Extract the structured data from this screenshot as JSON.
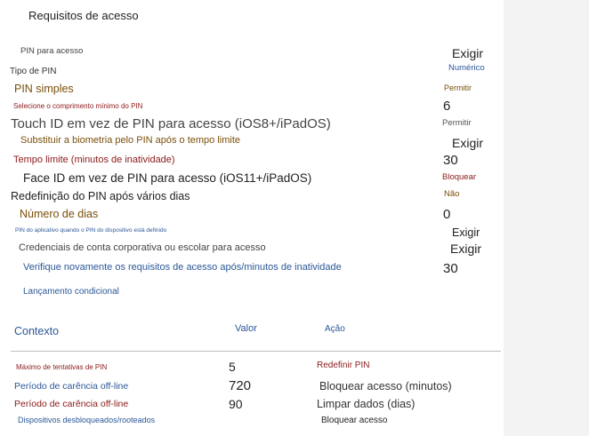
{
  "header": {
    "title": "Requisitos de acesso"
  },
  "settings": {
    "pin_acesso": {
      "label": "PIN para acesso",
      "value": "Exigir"
    },
    "tipo_pin": {
      "label": "Tipo de PIN",
      "value": "Numérico"
    },
    "pin_simples": {
      "label": "PIN simples",
      "value": "Permitir"
    },
    "comprimento_pin": {
      "label": "Selecione o comprimento mínimo do PIN",
      "value": "6"
    },
    "touch_id": {
      "label": "Touch ID em vez de PIN para acesso (iOS8+/iPadOS)",
      "value": "Permitir"
    },
    "biometria": {
      "label": "Substituir a biometria pelo PIN após o tempo limite",
      "value": "Exigir"
    },
    "tempo_limite": {
      "label": "Tempo limite (minutos de inatividade)",
      "value": "30"
    },
    "face_id": {
      "label": "Face ID em vez de PIN para acesso (iOS11+/iPadOS)",
      "value": "Bloquear"
    },
    "redefinicao_pin": {
      "label": "Redefinição do PIN após vários dias",
      "value": "Não"
    },
    "numero_dias": {
      "label": "Número de dias",
      "value": "0"
    },
    "pin_dispositivo": {
      "label": "PIN do aplicativo quando o PIN do dispositivo está definido",
      "value": "Exigir"
    },
    "credenciais": {
      "label": "Credenciais de conta corporativa ou escolar para acesso",
      "value": "Exigir"
    },
    "reverificar": {
      "label": "Verifique novamente os requisitos de acesso após/minutos de inatividade",
      "value": "30"
    }
  },
  "conditional": {
    "section_title": "Lançamento condicional",
    "headers": {
      "context": "Contexto",
      "value": "Valor",
      "action": "Ação"
    },
    "rows": [
      {
        "context": "Máximo de tentativas de PIN",
        "value": "5",
        "action": "Redefinir PIN"
      },
      {
        "context": "Período de carência off-line",
        "value": "720",
        "action": "Bloquear acesso (minutos)"
      },
      {
        "context": "Período de carência off-line",
        "value": "90",
        "action": "Limpar dados (dias)"
      },
      {
        "context": "Dispositivos desbloqueados/rooteados",
        "value": "",
        "action": "Bloquear acesso"
      }
    ]
  },
  "colors": {
    "accent_blue": "#2b5797",
    "label_brown": "#7a4f0a",
    "danger_red": "#8b1a1a"
  }
}
